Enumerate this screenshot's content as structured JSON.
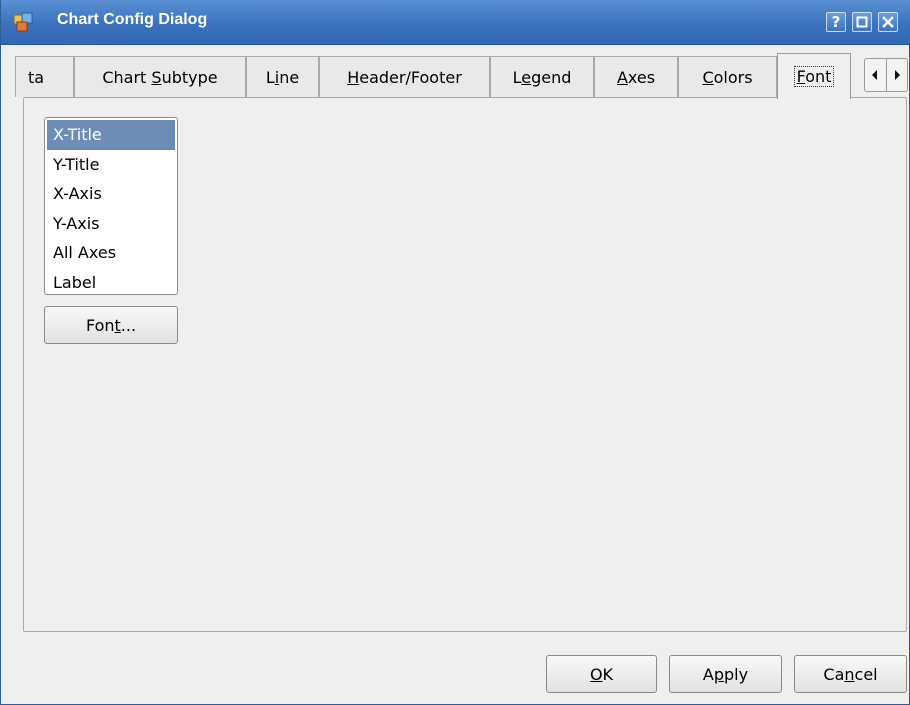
{
  "window": {
    "title": "Chart Config Dialog",
    "help_button": "?"
  },
  "tabs": [
    {
      "label": "ta",
      "mnemonic": ""
    },
    {
      "label": "Chart Subtype",
      "mnemonic": "S"
    },
    {
      "label": "Line",
      "mnemonic": "i"
    },
    {
      "label": "Header/Footer",
      "mnemonic": "H"
    },
    {
      "label": "Legend",
      "mnemonic": "e"
    },
    {
      "label": "Axes",
      "mnemonic": "A"
    },
    {
      "label": "Colors",
      "mnemonic": "C"
    },
    {
      "label": "Font",
      "mnemonic": "F",
      "active": true
    }
  ],
  "font_panel": {
    "items": [
      "X-Title",
      "Y-Title",
      "X-Axis",
      "Y-Axis",
      "All Axes",
      "Label"
    ],
    "selected": "X-Title",
    "font_button": "Font..."
  },
  "buttons": {
    "ok": "OK",
    "apply": "Apply",
    "cancel": "Cancel"
  },
  "colors": {
    "title_bar": "#3b72bd",
    "selection": "#6d8db6"
  }
}
